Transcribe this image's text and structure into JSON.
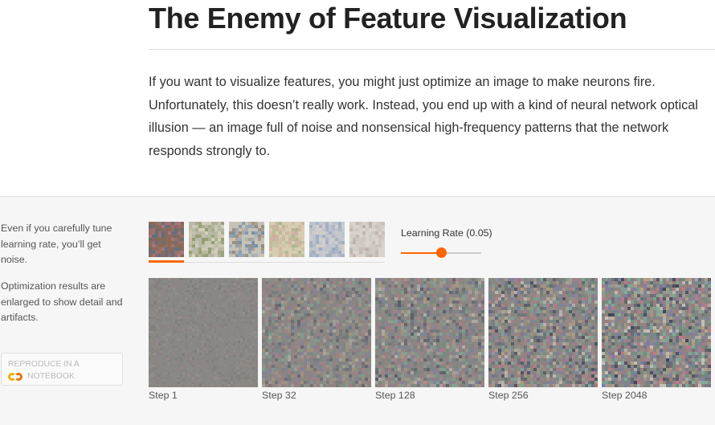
{
  "article": {
    "title": "The Enemy of Feature Visualization",
    "intro": "If you want to visualize features, you might just optimize an image to make neurons fire. Unfortunately, this doesn’t really work. Instead, you end up with a kind of neural network optical illusion — an image full of noise and nonsensical high-frequency patterns that the network responds strongly to."
  },
  "figure": {
    "caption_1": "Even if you carefully tune learning rate, you’ll get noise.",
    "caption_2": "Optimization results are enlarged to show detail and artifacts.",
    "reproduce": {
      "line_1": "Reproduce in a",
      "line_2": "Notebook",
      "icon": "colab-icon"
    },
    "thumbnails": [
      {
        "name": "thumb-1",
        "selected": true,
        "colors": [
          "#8a6a5a",
          "#5c6f82",
          "#b07a86"
        ]
      },
      {
        "name": "thumb-2",
        "selected": false,
        "colors": [
          "#b8b9a4",
          "#8f9a6c",
          "#d9d2bf"
        ]
      },
      {
        "name": "thumb-3",
        "selected": false,
        "colors": [
          "#c6c2b8",
          "#8f8474",
          "#6b86a8"
        ]
      },
      {
        "name": "thumb-4",
        "selected": false,
        "colors": [
          "#d6cdb0",
          "#c9a89c",
          "#a9b089"
        ]
      },
      {
        "name": "thumb-5",
        "selected": false,
        "colors": [
          "#bfc4cc",
          "#98a6be",
          "#d6d2cc"
        ]
      },
      {
        "name": "thumb-6",
        "selected": false,
        "colors": [
          "#d9d3cc",
          "#b9aca5",
          "#c8c4c0"
        ]
      }
    ],
    "learning_rate": {
      "label": "Learning Rate (0.05)",
      "value_fraction": 0.5
    },
    "steps": [
      {
        "label": "Step 1",
        "intensity": 0.15
      },
      {
        "label": "Step 32",
        "intensity": 0.5
      },
      {
        "label": "Step 128",
        "intensity": 0.65
      },
      {
        "label": "Step 256",
        "intensity": 0.8
      },
      {
        "label": "Step 2048",
        "intensity": 1.0
      }
    ],
    "colors": {
      "accent": "#ff6600"
    }
  }
}
